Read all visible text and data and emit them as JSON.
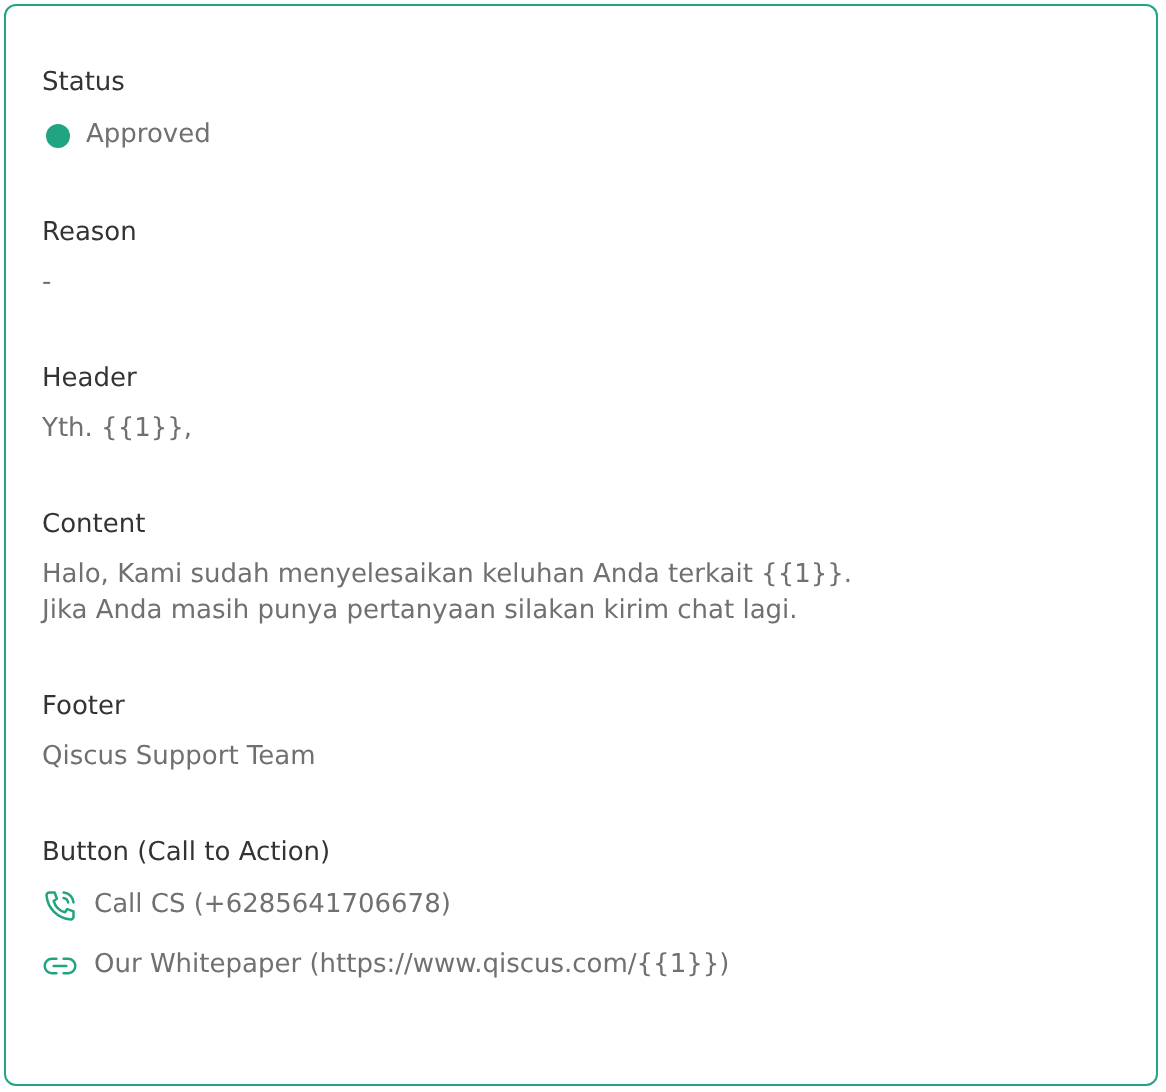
{
  "status": {
    "label": "Status",
    "value": "Approved",
    "color": "#20a482"
  },
  "sections": [
    {
      "label": "Reason",
      "value": "-"
    },
    {
      "label": "Header",
      "value": "Yth. {{1}},"
    },
    {
      "label": "Content",
      "value": "Halo, Kami sudah menyelesaikan keluhan Anda terkait {{1}}.\nJika Anda masih punya pertanyaan silakan kirim chat lagi."
    },
    {
      "label": "Footer",
      "value": "Qiscus Support Team"
    }
  ],
  "buttons": {
    "label": "Button (Call to Action)",
    "items": [
      {
        "kind": "call",
        "text": "Call CS (+6285641706678)"
      },
      {
        "kind": "url",
        "text": "Our Whitepaper (https://www.qiscus.com/{{1}})"
      }
    ]
  }
}
